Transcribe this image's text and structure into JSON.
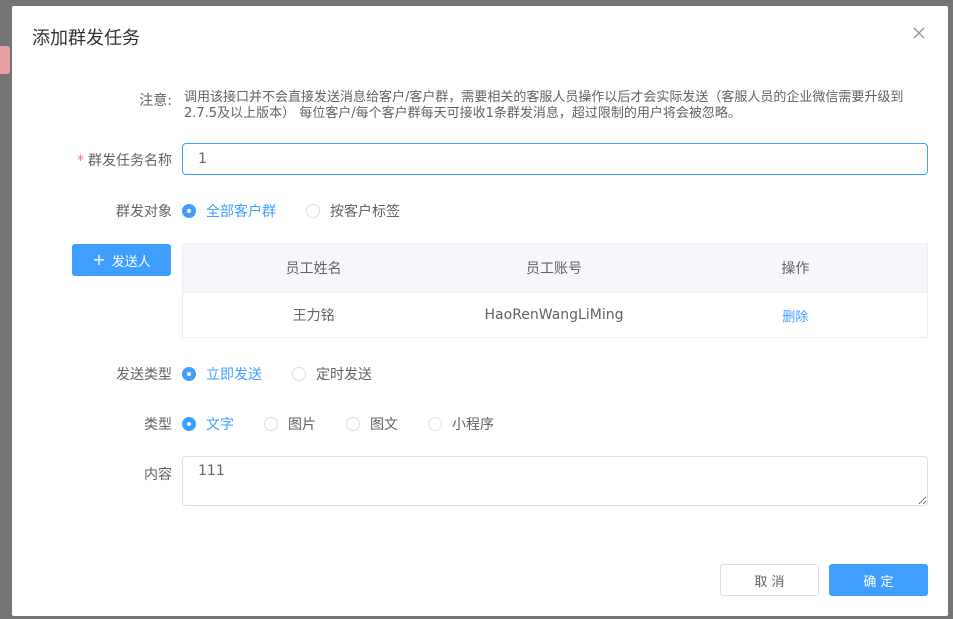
{
  "dialog": {
    "title": "添加群发任务"
  },
  "notice": {
    "label": "注意:",
    "text": "调用该接口并不会直接发送消息给客户/客户群，需要相关的客服人员操作以后才会实际发送（客服人员的企业微信需要升级到2.7.5及以上版本） 每位客户/每个客户群每天可接收1条群发消息，超过限制的用户将会被忽略。"
  },
  "task_name": {
    "label": "群发任务名称",
    "required_mark": "*",
    "value": "1"
  },
  "target": {
    "label": "群发对象",
    "options": [
      "全部客户群",
      "按客户标签"
    ],
    "selected": "全部客户群"
  },
  "sender": {
    "add_button": "发送人",
    "columns": [
      "员工姓名",
      "员工账号",
      "操作"
    ],
    "rows": [
      {
        "name": "王力铭",
        "account": "HaoRenWangLiMing",
        "action": "删除"
      }
    ]
  },
  "send_type": {
    "label": "发送类型",
    "options": [
      "立即发送",
      "定时发送"
    ],
    "selected": "立即发送"
  },
  "msg_type": {
    "label": "类型",
    "options": [
      "文字",
      "图片",
      "图文",
      "小程序"
    ],
    "selected": "文字"
  },
  "content": {
    "label": "内容",
    "value": "111"
  },
  "footer": {
    "cancel": "取 消",
    "confirm": "确 定"
  },
  "colors": {
    "primary": "#409eff",
    "required": "#f56c6c"
  }
}
